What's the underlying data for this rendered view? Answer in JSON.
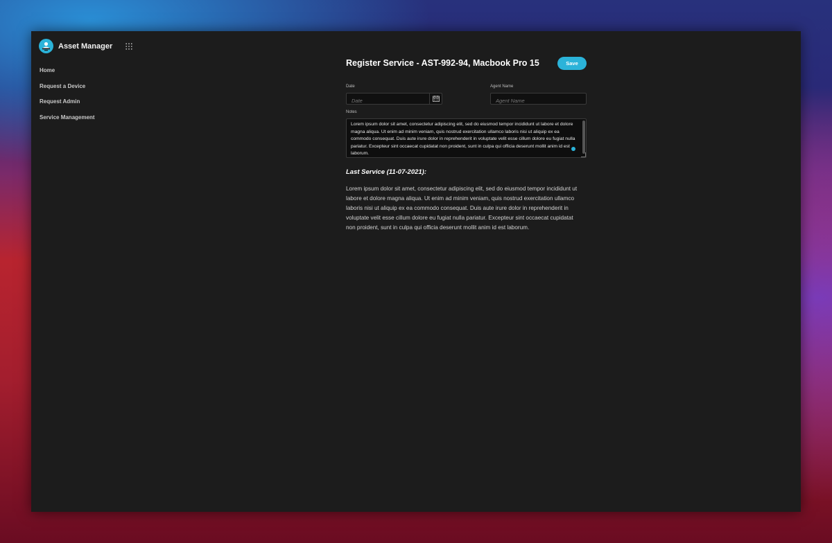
{
  "app": {
    "title": "Asset Manager",
    "logo_icon": "monitor-user-icon",
    "apps_icon": "grid-icon",
    "accent": "#2bb3d9"
  },
  "sidebar": {
    "items": [
      {
        "label": "Home"
      },
      {
        "label": "Request a Device"
      },
      {
        "label": "Request Admin"
      },
      {
        "label": "Service Management"
      }
    ]
  },
  "form": {
    "title": "Register Service - AST-992-94, Macbook Pro 15",
    "save_label": "Save",
    "date": {
      "label": "Date",
      "placeholder": "Date",
      "icon": "calendar-icon"
    },
    "agent": {
      "label": "Agent Name",
      "placeholder": "Agent Name"
    },
    "notes": {
      "label": "Notes",
      "value": "Lorem ipsum dolor sit amet, consectetur adipiscing elit, sed do eiusmod tempor incididunt ut labore et dolore magna aliqua. Ut enim ad minim veniam, quis nostrud exercitation ullamco laboris nisi ut aliquip ex ea commodo consequat. Duis aute irure dolor in reprehenderit in voluptate velit esse cillum dolore eu fugiat nulla pariatur. Excepteur sint occaecat cupidatat non proident, sunt in culpa qui officia deserunt mollit anim id est laborum."
    }
  },
  "last_service": {
    "title": "Last Service (11-07-2021):",
    "text": "Lorem ipsum dolor sit amet, consectetur adipiscing elit, sed do eiusmod tempor incididunt ut labore et dolore magna aliqua. Ut enim ad minim veniam, quis nostrud exercitation ullamco laboris nisi ut aliquip ex ea commodo consequat. Duis aute irure dolor in reprehenderit in voluptate velit esse cillum dolore eu fugiat nulla pariatur. Excepteur sint occaecat cupidatat non proident, sunt in culpa qui officia deserunt mollit anim id est laborum."
  }
}
